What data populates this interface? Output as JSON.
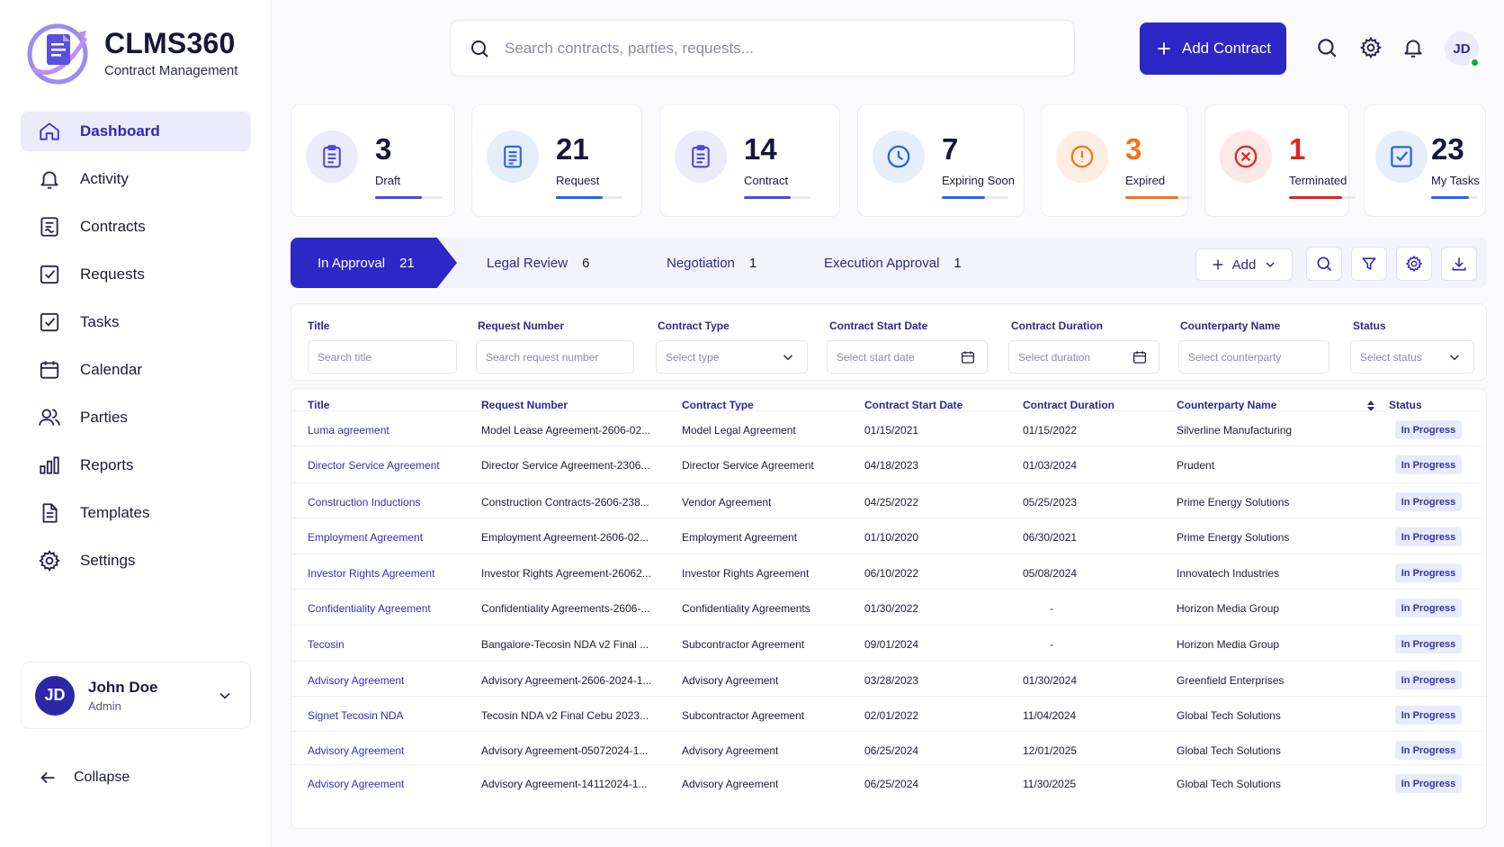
{
  "app": {
    "name": "CLMS360",
    "subtitle": "Contract Management"
  },
  "nav": [
    {
      "label": "Dashboard",
      "icon": "home-icon",
      "active": true
    },
    {
      "label": "Activity",
      "icon": "bell-icon"
    },
    {
      "label": "Contracts",
      "icon": "contract-icon"
    },
    {
      "label": "Requests",
      "icon": "checkbox-icon"
    },
    {
      "label": "Tasks",
      "icon": "checkbox-icon"
    },
    {
      "label": "Calendar",
      "icon": "calendar-icon"
    },
    {
      "label": "Parties",
      "icon": "users-icon"
    },
    {
      "label": "Reports",
      "icon": "bar-chart-icon"
    },
    {
      "label": "Templates",
      "icon": "document-icon"
    },
    {
      "label": "Settings",
      "icon": "gear-icon"
    }
  ],
  "user": {
    "initials": "JD",
    "name": "John Doe",
    "role": "Admin"
  },
  "collapse_label": "Collapse",
  "search": {
    "placeholder": "Search contracts, parties, requests..."
  },
  "add_contract_label": "Add Contract",
  "stats": [
    {
      "value": "3",
      "label": "Draft",
      "color": "#4f46e5",
      "bg": "#ecebfc",
      "progress": 0.7
    },
    {
      "value": "21",
      "label": "Request",
      "color": "#2563eb",
      "bg": "#e6eefc",
      "progress": 0.7
    },
    {
      "value": "14",
      "label": "Contract",
      "color": "#4f46e5",
      "bg": "#ecebfc",
      "progress": 0.7
    },
    {
      "value": "7",
      "label": "Expiring Soon",
      "color": "#2563eb",
      "bg": "#e6eefc",
      "progress": 0.65
    },
    {
      "value": "3",
      "label": "Expired",
      "color": "#f97316",
      "bg": "#fdeee3",
      "progress": 0.8
    },
    {
      "value": "1",
      "label": "Terminated",
      "color": "#dc2626",
      "bg": "#fde7e7",
      "progress": 0.8
    },
    {
      "value": "23",
      "label": "My Tasks",
      "color": "#2563eb",
      "bg": "#e6eefc",
      "progress": 0.8
    }
  ],
  "tabs": [
    {
      "label": "In Approval",
      "count": "21"
    },
    {
      "label": "Legal Review",
      "count": "6"
    },
    {
      "label": "Negotiation",
      "count": "1"
    },
    {
      "label": "Execution Approval",
      "count": "1"
    }
  ],
  "toolbar": {
    "add_label": "Add"
  },
  "filters": [
    {
      "label": "Title",
      "placeholder": "Search title"
    },
    {
      "label": "Request Number",
      "placeholder": "Search request number"
    },
    {
      "label": "Contract Type",
      "placeholder": "Select type"
    },
    {
      "label": "Contract Start Date",
      "placeholder": "Select start date"
    },
    {
      "label": "Contract Duration",
      "placeholder": "Select duration"
    },
    {
      "label": "Counterparty Name",
      "placeholder": "Select counterparty"
    },
    {
      "label": "Status",
      "placeholder": "Select status"
    }
  ],
  "table": {
    "headers": [
      "Title",
      "Request Number",
      "Contract Type",
      "Contract Start Date",
      "Contract Duration",
      "Counterparty Name",
      "Status"
    ],
    "rows": [
      [
        "Luma agreement",
        "Model Lease Agreement-2606-02...",
        "Model Legal Agreement",
        "01/15/2021",
        "01/15/2022",
        "Silverline Manufacturing",
        "In Progress"
      ],
      [
        "Director Service Agreement",
        "Director Service Agreement-2306...",
        "Director Service Agreement",
        "04/18/2023",
        "01/03/2024",
        "Prudent",
        "In Progress"
      ],
      [
        "Construction Inductions",
        "Construction Contracts-2606-238...",
        "Vendor Agreement",
        "04/25/2022",
        "05/25/2023",
        "Prime Energy Solutions",
        "In Progress"
      ],
      [
        "Employment Agreement",
        "Employment Agreement-2606-02...",
        "Employment Agreement",
        "01/10/2020",
        "06/30/2021",
        "Prime Energy Solutions",
        "In Progress"
      ],
      [
        "Investor Rights Agreement",
        "Investor Rights Agreement-26062...",
        "Investor Rights Agreement",
        "06/10/2022",
        "05/08/2024",
        "Innovatech Industries",
        "In Progress"
      ],
      [
        "Confidentiality Agreement",
        "Confidentiality Agreements-2606-...",
        "Confidentiality Agreements",
        "01/30/2022",
        "-",
        "Horizon Media Group",
        "In Progress"
      ],
      [
        "Tecosin",
        "Bangalore-Tecosin NDA v2 Final ...",
        "Subcontractor Agreement",
        "09/01/2024",
        "-",
        "Horizon Media Group",
        "In Progress"
      ],
      [
        "Advisory Agreement",
        "Advisory Agreement-2606-2024-1...",
        "Advisory Agreement",
        "03/28/2023",
        "01/30/2024",
        "Greenfield Enterprises",
        "In Progress"
      ],
      [
        "Signet Tecosin NDA",
        "Tecosin NDA v2 Final Cebu 2023...",
        "Subcontractor Agreement",
        "02/01/2022",
        "11/04/2024",
        "Global Tech Solutions",
        "In Progress"
      ],
      [
        "Advisory Agreement",
        "Advisory Agreement-05072024-1...",
        "Advisory Agreement",
        "06/25/2024",
        "12/01/2025",
        "Global Tech Solutions",
        "In Progress"
      ],
      [
        "Advisory Agreement",
        "Advisory Agreement-14112024-1...",
        "Advisory Agreement",
        "06/25/2024",
        "11/30/2025",
        "Global Tech Solutions",
        "In Progress"
      ]
    ]
  }
}
